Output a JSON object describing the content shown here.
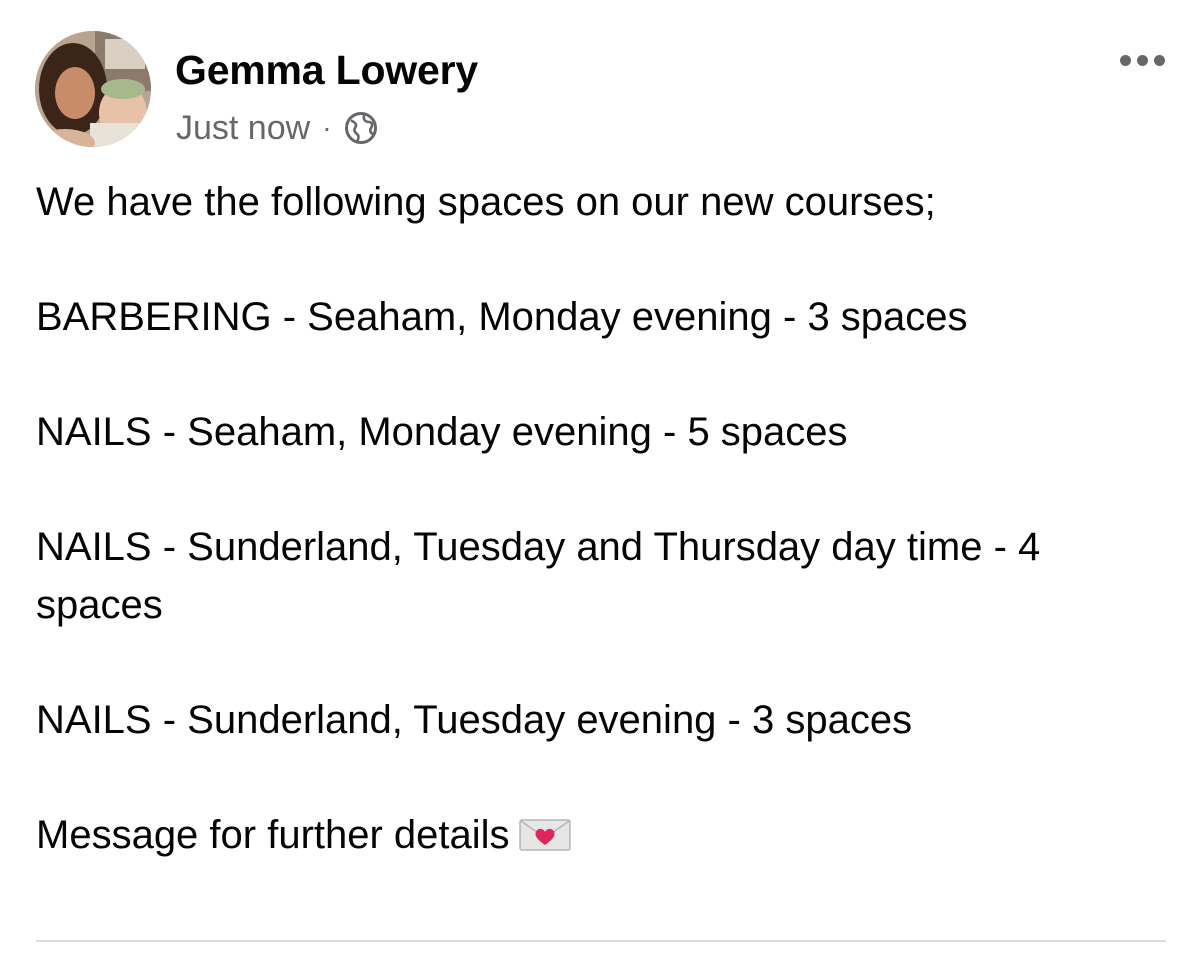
{
  "post": {
    "author": "Gemma Lowery",
    "timestamp": "Just now",
    "separator": "·",
    "audience_icon": "globe-icon",
    "more_icon": "more-options-icon",
    "intro": "We have the following spaces on our new courses;",
    "courses": [
      "BARBERING - Seaham, Monday evening - 3 spaces",
      "NAILS - Seaham, Monday evening - 5 spaces",
      "NAILS - Sunderland, Tuesday and Thursday day time - 4 spaces",
      "NAILS - Sunderland, Tuesday evening - 3 spaces"
    ],
    "closing": "Message for further details",
    "closing_emoji": "love-letter-icon"
  },
  "colors": {
    "text": "#050505",
    "secondary_text": "#65676b",
    "divider": "#dadde1",
    "heart": "#e0245e"
  }
}
